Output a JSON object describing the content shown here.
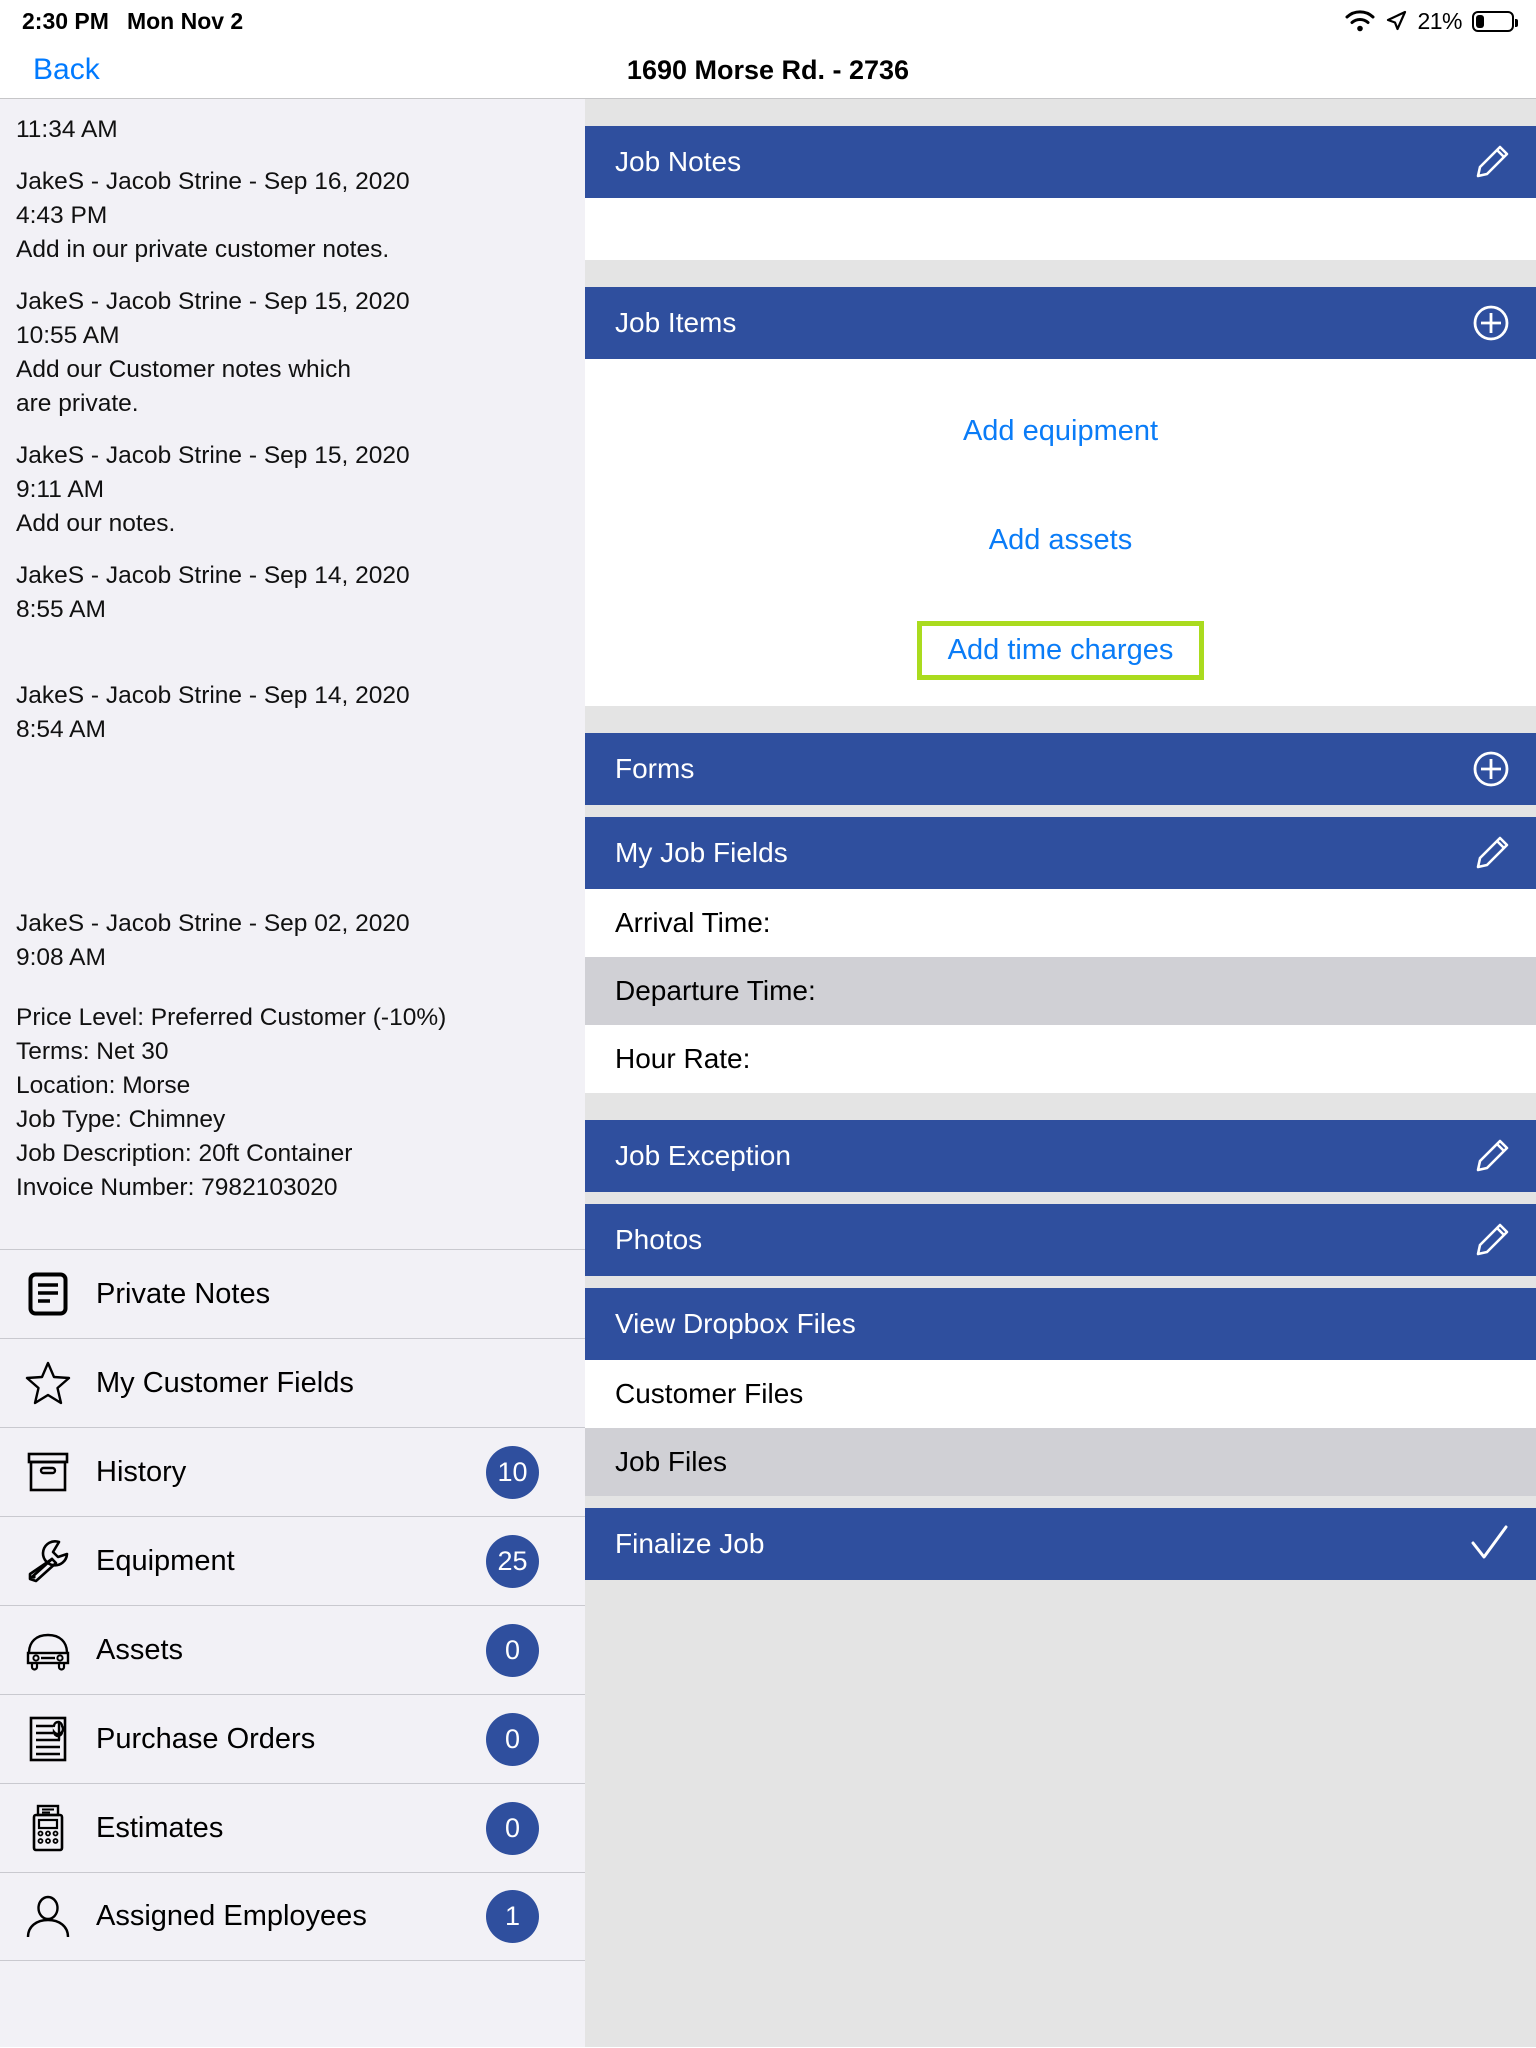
{
  "status_bar": {
    "time": "2:30 PM",
    "date": "Mon Nov 2",
    "wifi_icon": "wifi-icon",
    "location_icon": "location-arrow-icon",
    "battery_percent": "21%",
    "battery_icon": "battery-icon"
  },
  "navbar": {
    "back_label": "Back",
    "title": "1690 Morse Rd. - 2736"
  },
  "left_panel": {
    "notes": [
      {
        "text": "11:34 AM",
        "spacing": "normal"
      },
      {
        "text": "JakeS - Jacob Strine - Sep 16, 2020\n4:43 PM\nAdd in our private customer notes.",
        "spacing": "normal"
      },
      {
        "text": "JakeS - Jacob Strine - Sep 15, 2020\n10:55 AM\nAdd our Customer notes which\nare private.",
        "spacing": "normal"
      },
      {
        "text": "JakeS - Jacob Strine - Sep 15, 2020\n9:11 AM\nAdd our notes.",
        "spacing": "normal"
      },
      {
        "text": "JakeS - Jacob Strine - Sep 14, 2020\n8:55 AM",
        "spacing": "tall"
      },
      {
        "text": "JakeS - Jacob Strine - Sep 14, 2020\n8:54 AM",
        "spacing": "xtall"
      },
      {
        "text": "JakeS - Jacob Strine - Sep 02, 2020\n9:08 AM",
        "spacing": "normal"
      }
    ],
    "meta": "Price Level: Preferred Customer (-10%)\nTerms: Net 30\nLocation: Morse\nJob Type: Chimney\nJob Description: 20ft Container\nInvoice Number: 7982103020",
    "menu": [
      {
        "label": "Private Notes",
        "icon": "notes-document-icon",
        "badge": null
      },
      {
        "label": "My Customer Fields",
        "icon": "star-icon",
        "badge": null
      },
      {
        "label": "History",
        "icon": "archive-box-icon",
        "badge": "10"
      },
      {
        "label": "Equipment",
        "icon": "wrench-icon",
        "badge": "25"
      },
      {
        "label": "Assets",
        "icon": "car-icon",
        "badge": "0"
      },
      {
        "label": "Purchase Orders",
        "icon": "invoice-dollar-icon",
        "badge": "0"
      },
      {
        "label": "Estimates",
        "icon": "calculator-icon",
        "badge": "0"
      },
      {
        "label": "Assigned Employees",
        "icon": "person-icon",
        "badge": "1"
      }
    ]
  },
  "right_panel": {
    "job_notes": {
      "title": "Job Notes",
      "action_icon": "pencil-icon"
    },
    "job_items": {
      "title": "Job Items",
      "action_icon": "plus-circle-icon",
      "links": [
        {
          "label": "Add equipment",
          "highlighted": false
        },
        {
          "label": "Add assets",
          "highlighted": false
        },
        {
          "label": "Add time charges",
          "highlighted": true
        }
      ]
    },
    "forms": {
      "title": "Forms",
      "action_icon": "plus-circle-icon"
    },
    "my_job_fields": {
      "title": "My Job Fields",
      "action_icon": "pencil-icon",
      "rows": [
        {
          "label": "Arrival Time:",
          "alt": false
        },
        {
          "label": "Departure Time:",
          "alt": true
        },
        {
          "label": "Hour Rate:",
          "alt": false
        }
      ]
    },
    "job_exception": {
      "title": "Job Exception",
      "action_icon": "pencil-icon"
    },
    "photos": {
      "title": "Photos",
      "action_icon": "pencil-icon"
    },
    "dropbox": {
      "title": "View Dropbox Files",
      "rows": [
        {
          "label": "Customer Files",
          "alt": false
        },
        {
          "label": "Job Files",
          "alt": true
        }
      ]
    },
    "finalize": {
      "title": "Finalize Job",
      "action_icon": "checkmark-icon"
    }
  },
  "colors": {
    "header_blue": "#2f4f9e",
    "link_blue": "#0a7cf7",
    "back_blue": "#007aff",
    "highlight_green": "#aadb1e",
    "panel_gray": "#e4e4e4",
    "sidebar_gray": "#f2f1f6",
    "row_alt_gray": "#d0d0d5"
  }
}
